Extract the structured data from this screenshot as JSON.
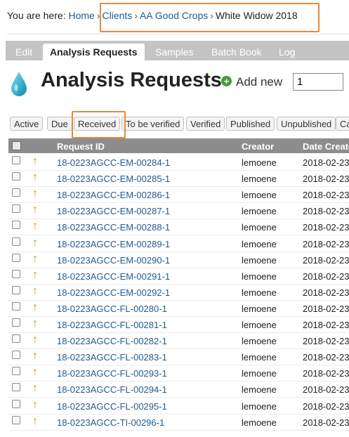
{
  "breadcrumb": {
    "prefix": "You are here:",
    "items": [
      "Home",
      "Clients",
      "AA Good Crops",
      "White Widow 2018"
    ],
    "separator": "›"
  },
  "tabs": [
    {
      "label": "Edit",
      "active": false
    },
    {
      "label": "Analysis Requests",
      "active": true
    },
    {
      "label": "Samples",
      "active": false
    },
    {
      "label": "Batch Book",
      "active": false
    },
    {
      "label": "Log",
      "active": false
    }
  ],
  "header": {
    "title": "Analysis Requests",
    "icon": "water-drop-icon",
    "add_new_label": "Add new",
    "add_count_value": "1"
  },
  "filters": [
    "Active",
    "Due",
    "Received",
    "To be verified",
    "Verified",
    "Published",
    "Unpublished",
    "Ca"
  ],
  "selected_filter": "Received",
  "table": {
    "columns": [
      "Request ID",
      "Creator",
      "Date Create"
    ],
    "rows": [
      {
        "id": "18-0223AGCC-EM-00284-1",
        "creator": "lemoene",
        "date": "2018-02-23"
      },
      {
        "id": "18-0223AGCC-EM-00285-1",
        "creator": "lemoene",
        "date": "2018-02-23"
      },
      {
        "id": "18-0223AGCC-EM-00286-1",
        "creator": "lemoene",
        "date": "2018-02-23"
      },
      {
        "id": "18-0223AGCC-EM-00287-1",
        "creator": "lemoene",
        "date": "2018-02-23"
      },
      {
        "id": "18-0223AGCC-EM-00288-1",
        "creator": "lemoene",
        "date": "2018-02-23"
      },
      {
        "id": "18-0223AGCC-EM-00289-1",
        "creator": "lemoene",
        "date": "2018-02-23"
      },
      {
        "id": "18-0223AGCC-EM-00290-1",
        "creator": "lemoene",
        "date": "2018-02-23"
      },
      {
        "id": "18-0223AGCC-EM-00291-1",
        "creator": "lemoene",
        "date": "2018-02-23"
      },
      {
        "id": "18-0223AGCC-EM-00292-1",
        "creator": "lemoene",
        "date": "2018-02-23"
      },
      {
        "id": "18-0223AGCC-FL-00280-1",
        "creator": "lemoene",
        "date": "2018-02-23"
      },
      {
        "id": "18-0223AGCC-FL-00281-1",
        "creator": "lemoene",
        "date": "2018-02-23"
      },
      {
        "id": "18-0223AGCC-FL-00282-1",
        "creator": "lemoene",
        "date": "2018-02-23"
      },
      {
        "id": "18-0223AGCC-FL-00283-1",
        "creator": "lemoene",
        "date": "2018-02-23"
      },
      {
        "id": "18-0223AGCC-FL-00293-1",
        "creator": "lemoene",
        "date": "2018-02-23"
      },
      {
        "id": "18-0223AGCC-FL-00294-1",
        "creator": "lemoene",
        "date": "2018-02-23"
      },
      {
        "id": "18-0223AGCC-FL-00295-1",
        "creator": "lemoene",
        "date": "2018-02-23"
      },
      {
        "id": "18-0223AGCC-TI-00296-1",
        "creator": "lemoene",
        "date": "2018-02-23"
      }
    ]
  },
  "colors": {
    "link": "#205c90",
    "highlight": "#e8893a",
    "priority_arrow": "#e8862a",
    "tabbar": "#c4c4c4",
    "table_header": "#8d8d8d"
  }
}
